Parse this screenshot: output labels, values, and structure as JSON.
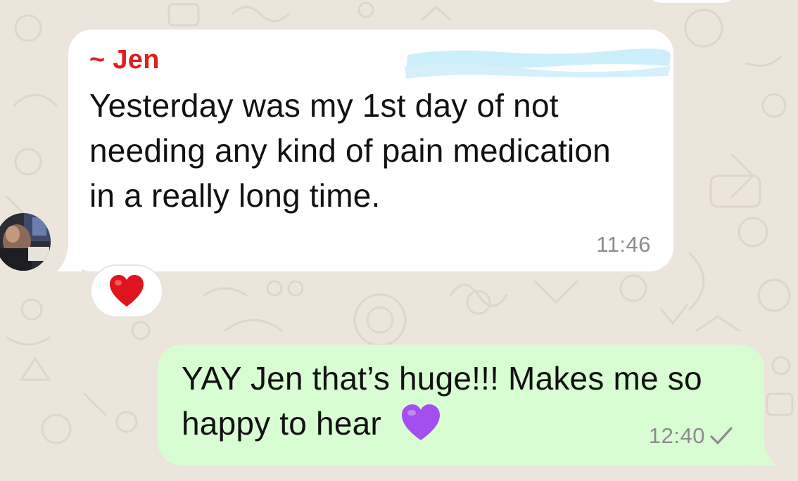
{
  "incoming_message": {
    "sender": "~ Jen",
    "text": "Yesterday was my 1st day of not needing any kind of pain medication in a really long time.",
    "time": "11:46",
    "reaction": "heart",
    "reaction_color": "#e0141e"
  },
  "outgoing_message": {
    "text": "YAY Jen that’s huge!!! Makes me so happy to hear",
    "emoji": "purple-heart",
    "emoji_color": "#a24ff0",
    "time": "12:40",
    "status": "sent-check"
  },
  "colors": {
    "wallpaper": "#ebe5dc",
    "incoming_bubble": "#ffffff",
    "outgoing_bubble": "#d9fdd3",
    "sender_name": "#e11d1d",
    "timestamp": "#8c8c8c"
  }
}
